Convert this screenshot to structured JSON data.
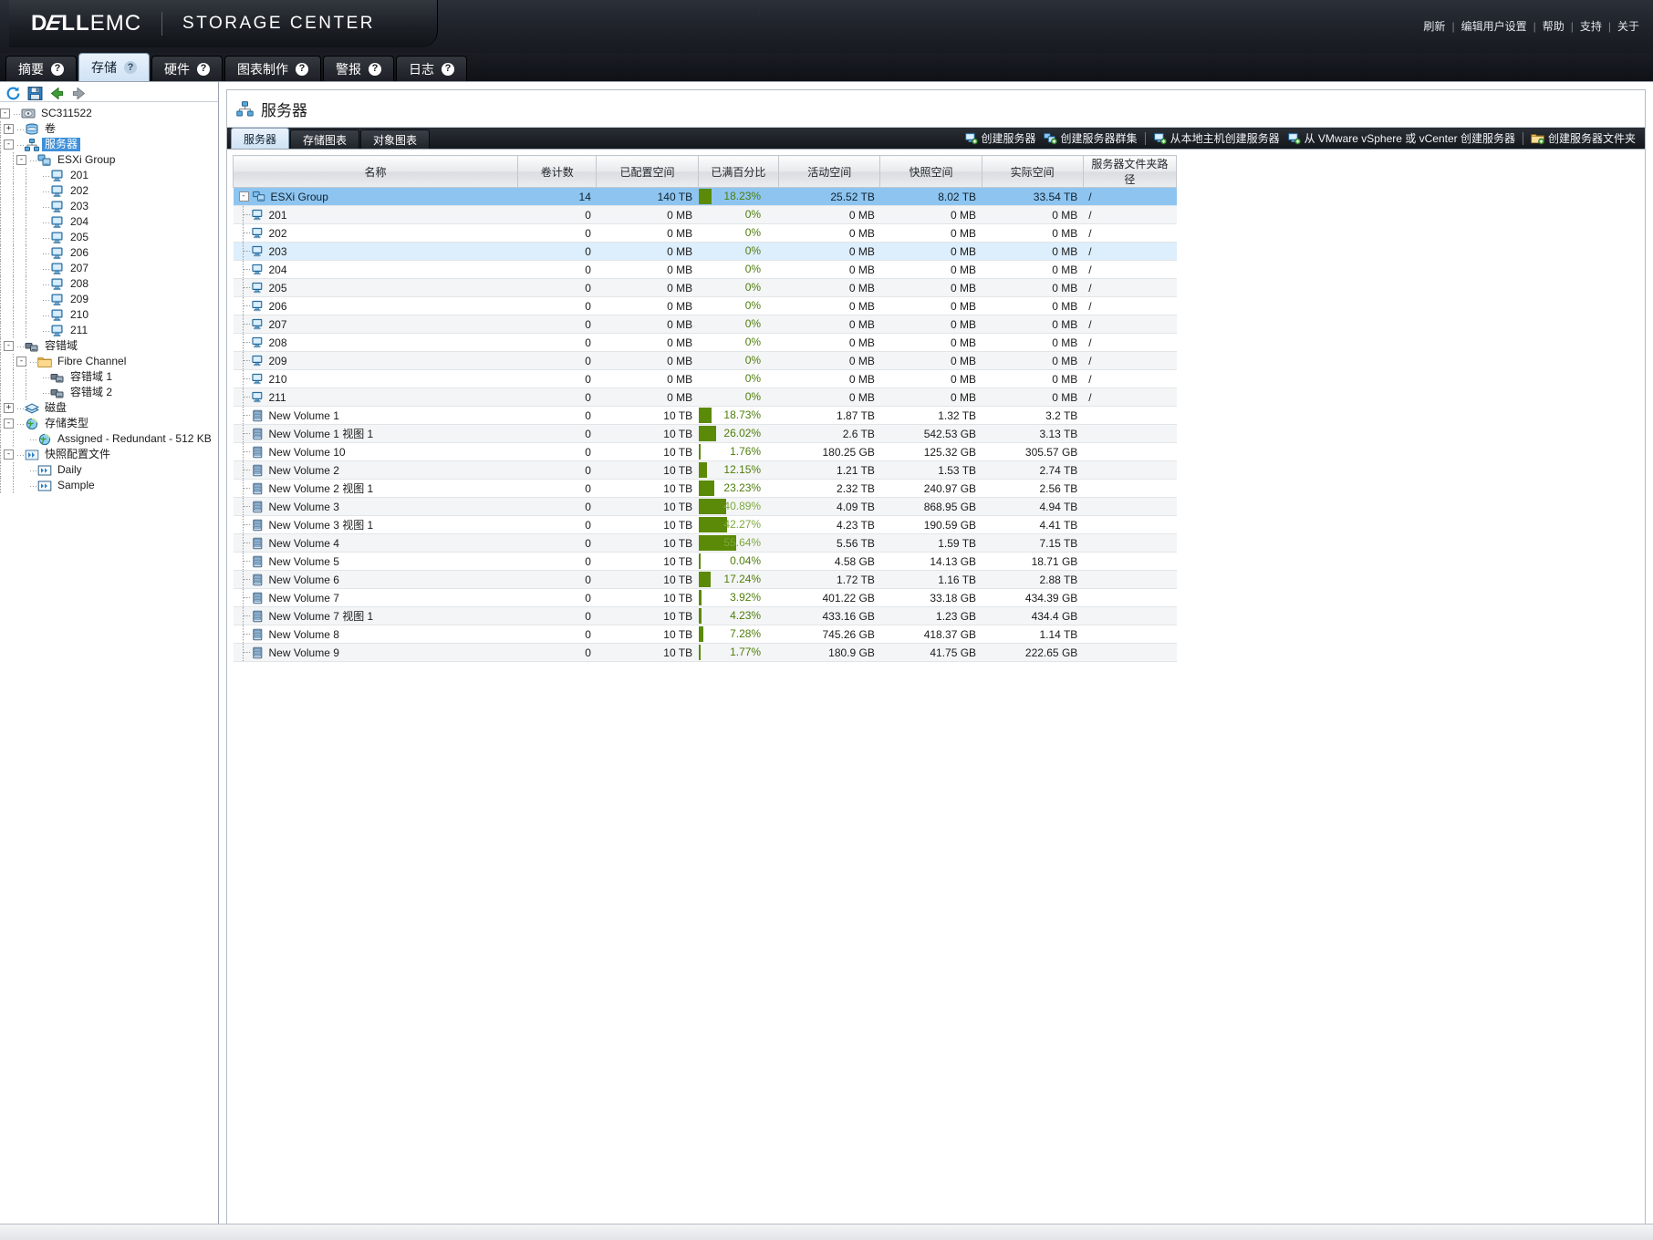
{
  "header": {
    "brand_dell": "D",
    "brand_dell_rest": "LL",
    "brand_emc": "EMC",
    "product": "STORAGE CENTER",
    "links": [
      "刷新",
      "编辑用户设置",
      "帮助",
      "支持",
      "关于"
    ]
  },
  "main_tabs": [
    {
      "label": "摘要",
      "active": false,
      "help": "?"
    },
    {
      "label": "存储",
      "active": true,
      "help": "?"
    },
    {
      "label": "硬件",
      "active": false,
      "help": "?"
    },
    {
      "label": "图表制作",
      "active": false,
      "help": "?"
    },
    {
      "label": "警报",
      "active": false,
      "help": "?"
    },
    {
      "label": "日志",
      "active": false,
      "help": "?"
    }
  ],
  "tree_toolbar": [
    {
      "name": "refresh-icon",
      "title": "刷新"
    },
    {
      "name": "save-icon",
      "title": "保存"
    },
    {
      "name": "back-arrow-icon",
      "title": "后退"
    },
    {
      "name": "forward-arrow-icon",
      "title": "前进"
    }
  ],
  "tree": [
    {
      "label": "SC311522",
      "depth": 0,
      "twist": "-",
      "icon": "storage-center-icon",
      "selected": false
    },
    {
      "label": "卷",
      "depth": 1,
      "twist": "+",
      "icon": "volumes-icon",
      "selected": false
    },
    {
      "label": "服务器",
      "depth": 1,
      "twist": "-",
      "icon": "servers-icon",
      "selected": true
    },
    {
      "label": "ESXi Group",
      "depth": 2,
      "twist": "-",
      "icon": "server-cluster-icon",
      "selected": false
    },
    {
      "label": "201",
      "depth": 3,
      "twist": "",
      "icon": "server-icon",
      "selected": false
    },
    {
      "label": "202",
      "depth": 3,
      "twist": "",
      "icon": "server-icon",
      "selected": false
    },
    {
      "label": "203",
      "depth": 3,
      "twist": "",
      "icon": "server-icon",
      "selected": false
    },
    {
      "label": "204",
      "depth": 3,
      "twist": "",
      "icon": "server-icon",
      "selected": false
    },
    {
      "label": "205",
      "depth": 3,
      "twist": "",
      "icon": "server-icon",
      "selected": false
    },
    {
      "label": "206",
      "depth": 3,
      "twist": "",
      "icon": "server-icon",
      "selected": false
    },
    {
      "label": "207",
      "depth": 3,
      "twist": "",
      "icon": "server-icon",
      "selected": false
    },
    {
      "label": "208",
      "depth": 3,
      "twist": "",
      "icon": "server-icon",
      "selected": false
    },
    {
      "label": "209",
      "depth": 3,
      "twist": "",
      "icon": "server-icon",
      "selected": false
    },
    {
      "label": "210",
      "depth": 3,
      "twist": "",
      "icon": "server-icon",
      "selected": false
    },
    {
      "label": "211",
      "depth": 3,
      "twist": "",
      "icon": "server-icon",
      "selected": false
    },
    {
      "label": "容错域",
      "depth": 1,
      "twist": "-",
      "icon": "fault-domain-icon",
      "selected": false
    },
    {
      "label": "Fibre Channel",
      "depth": 2,
      "twist": "-",
      "icon": "folder-icon",
      "selected": false
    },
    {
      "label": "容错域 1",
      "depth": 3,
      "twist": "",
      "icon": "fault-domain-icon",
      "selected": false
    },
    {
      "label": "容错域 2",
      "depth": 3,
      "twist": "",
      "icon": "fault-domain-icon",
      "selected": false
    },
    {
      "label": "磁盘",
      "depth": 1,
      "twist": "+",
      "icon": "disks-icon",
      "selected": false
    },
    {
      "label": "存储类型",
      "depth": 1,
      "twist": "-",
      "icon": "storage-type-icon",
      "selected": false
    },
    {
      "label": "Assigned - Redundant - 512 KB",
      "depth": 2,
      "twist": "",
      "icon": "storage-type-icon",
      "selected": false
    },
    {
      "label": "快照配置文件",
      "depth": 1,
      "twist": "-",
      "icon": "snapshot-profile-icon",
      "selected": false
    },
    {
      "label": "Daily",
      "depth": 2,
      "twist": "",
      "icon": "snapshot-icon",
      "selected": false
    },
    {
      "label": "Sample",
      "depth": 2,
      "twist": "",
      "icon": "snapshot-icon",
      "selected": false
    }
  ],
  "panel": {
    "title": "服务器",
    "title_icon": "servers-icon",
    "sub_tabs": [
      {
        "label": "服务器",
        "active": true
      },
      {
        "label": "存储图表",
        "active": false
      },
      {
        "label": "对象图表",
        "active": false
      }
    ],
    "actions": [
      {
        "label": "创建服务器",
        "icon": "create-server-icon",
        "sep_after": false
      },
      {
        "label": "创建服务器群集",
        "icon": "create-server-cluster-icon",
        "sep_after": true
      },
      {
        "label": "从本地主机创建服务器",
        "icon": "create-server-from-localhost-icon",
        "sep_after": false
      },
      {
        "label": "从 VMware vSphere 或 vCenter 创建服务器",
        "icon": "create-server-from-vmware-icon",
        "sep_after": true
      },
      {
        "label": "创建服务器文件夹",
        "icon": "create-server-folder-icon",
        "sep_after": false
      }
    ]
  },
  "table": {
    "columns": [
      "名称",
      "卷计数",
      "已配置空间",
      "已满百分比",
      "活动空间",
      "快照空间",
      "实际空间",
      "服务器文件夹路径"
    ],
    "rows": [
      {
        "name": "ESXi Group",
        "kind": "group",
        "icon": "server-cluster-icon",
        "twist": "-",
        "indent": 0,
        "volumes": "14",
        "configured": "140 TB",
        "percent_full": "18.23%",
        "percent_value": 18.23,
        "active": "25.52 TB",
        "snapshot": "8.02 TB",
        "actual": "33.54 TB",
        "folder": "/",
        "selected": true,
        "hover": false
      },
      {
        "name": "201",
        "kind": "server",
        "icon": "server-icon",
        "twist": "",
        "indent": 1,
        "volumes": "0",
        "configured": "0 MB",
        "percent_full": "0%",
        "percent_value": 0,
        "active": "0 MB",
        "snapshot": "0 MB",
        "actual": "0 MB",
        "folder": "/",
        "selected": false,
        "hover": false
      },
      {
        "name": "202",
        "kind": "server",
        "icon": "server-icon",
        "twist": "",
        "indent": 1,
        "volumes": "0",
        "configured": "0 MB",
        "percent_full": "0%",
        "percent_value": 0,
        "active": "0 MB",
        "snapshot": "0 MB",
        "actual": "0 MB",
        "folder": "/",
        "selected": false,
        "hover": false
      },
      {
        "name": "203",
        "kind": "server",
        "icon": "server-icon",
        "twist": "",
        "indent": 1,
        "volumes": "0",
        "configured": "0 MB",
        "percent_full": "0%",
        "percent_value": 0,
        "active": "0 MB",
        "snapshot": "0 MB",
        "actual": "0 MB",
        "folder": "/",
        "selected": false,
        "hover": true
      },
      {
        "name": "204",
        "kind": "server",
        "icon": "server-icon",
        "twist": "",
        "indent": 1,
        "volumes": "0",
        "configured": "0 MB",
        "percent_full": "0%",
        "percent_value": 0,
        "active": "0 MB",
        "snapshot": "0 MB",
        "actual": "0 MB",
        "folder": "/",
        "selected": false,
        "hover": false
      },
      {
        "name": "205",
        "kind": "server",
        "icon": "server-icon",
        "twist": "",
        "indent": 1,
        "volumes": "0",
        "configured": "0 MB",
        "percent_full": "0%",
        "percent_value": 0,
        "active": "0 MB",
        "snapshot": "0 MB",
        "actual": "0 MB",
        "folder": "/",
        "selected": false,
        "hover": false
      },
      {
        "name": "206",
        "kind": "server",
        "icon": "server-icon",
        "twist": "",
        "indent": 1,
        "volumes": "0",
        "configured": "0 MB",
        "percent_full": "0%",
        "percent_value": 0,
        "active": "0 MB",
        "snapshot": "0 MB",
        "actual": "0 MB",
        "folder": "/",
        "selected": false,
        "hover": false
      },
      {
        "name": "207",
        "kind": "server",
        "icon": "server-icon",
        "twist": "",
        "indent": 1,
        "volumes": "0",
        "configured": "0 MB",
        "percent_full": "0%",
        "percent_value": 0,
        "active": "0 MB",
        "snapshot": "0 MB",
        "actual": "0 MB",
        "folder": "/",
        "selected": false,
        "hover": false
      },
      {
        "name": "208",
        "kind": "server",
        "icon": "server-icon",
        "twist": "",
        "indent": 1,
        "volumes": "0",
        "configured": "0 MB",
        "percent_full": "0%",
        "percent_value": 0,
        "active": "0 MB",
        "snapshot": "0 MB",
        "actual": "0 MB",
        "folder": "/",
        "selected": false,
        "hover": false
      },
      {
        "name": "209",
        "kind": "server",
        "icon": "server-icon",
        "twist": "",
        "indent": 1,
        "volumes": "0",
        "configured": "0 MB",
        "percent_full": "0%",
        "percent_value": 0,
        "active": "0 MB",
        "snapshot": "0 MB",
        "actual": "0 MB",
        "folder": "/",
        "selected": false,
        "hover": false
      },
      {
        "name": "210",
        "kind": "server",
        "icon": "server-icon",
        "twist": "",
        "indent": 1,
        "volumes": "0",
        "configured": "0 MB",
        "percent_full": "0%",
        "percent_value": 0,
        "active": "0 MB",
        "snapshot": "0 MB",
        "actual": "0 MB",
        "folder": "/",
        "selected": false,
        "hover": false
      },
      {
        "name": "211",
        "kind": "server",
        "icon": "server-icon",
        "twist": "",
        "indent": 1,
        "volumes": "0",
        "configured": "0 MB",
        "percent_full": "0%",
        "percent_value": 0,
        "active": "0 MB",
        "snapshot": "0 MB",
        "actual": "0 MB",
        "folder": "/",
        "selected": false,
        "hover": false
      },
      {
        "name": "New Volume 1",
        "kind": "volume",
        "icon": "volume-icon",
        "twist": "",
        "indent": 1,
        "volumes": "0",
        "configured": "10 TB",
        "percent_full": "18.73%",
        "percent_value": 18.73,
        "active": "1.87 TB",
        "snapshot": "1.32 TB",
        "actual": "3.2 TB",
        "folder": "",
        "selected": false,
        "hover": false
      },
      {
        "name": "New Volume 1 视图 1",
        "kind": "volume",
        "icon": "volume-icon",
        "twist": "",
        "indent": 1,
        "volumes": "0",
        "configured": "10 TB",
        "percent_full": "26.02%",
        "percent_value": 26.02,
        "active": "2.6 TB",
        "snapshot": "542.53 GB",
        "actual": "3.13 TB",
        "folder": "",
        "selected": false,
        "hover": false
      },
      {
        "name": "New Volume 10",
        "kind": "volume",
        "icon": "volume-icon",
        "twist": "",
        "indent": 1,
        "volumes": "0",
        "configured": "10 TB",
        "percent_full": "1.76%",
        "percent_value": 1.76,
        "active": "180.25 GB",
        "snapshot": "125.32 GB",
        "actual": "305.57 GB",
        "folder": "",
        "selected": false,
        "hover": false
      },
      {
        "name": "New Volume 2",
        "kind": "volume",
        "icon": "volume-icon",
        "twist": "",
        "indent": 1,
        "volumes": "0",
        "configured": "10 TB",
        "percent_full": "12.15%",
        "percent_value": 12.15,
        "active": "1.21 TB",
        "snapshot": "1.53 TB",
        "actual": "2.74 TB",
        "folder": "",
        "selected": false,
        "hover": false
      },
      {
        "name": "New Volume 2 视图 1",
        "kind": "volume",
        "icon": "volume-icon",
        "twist": "",
        "indent": 1,
        "volumes": "0",
        "configured": "10 TB",
        "percent_full": "23.23%",
        "percent_value": 23.23,
        "active": "2.32 TB",
        "snapshot": "240.97 GB",
        "actual": "2.56 TB",
        "folder": "",
        "selected": false,
        "hover": false
      },
      {
        "name": "New Volume 3",
        "kind": "volume",
        "icon": "volume-icon",
        "twist": "",
        "indent": 1,
        "volumes": "0",
        "configured": "10 TB",
        "percent_full": "40.89%",
        "percent_value": 40.89,
        "active": "4.09 TB",
        "snapshot": "868.95 GB",
        "actual": "4.94 TB",
        "folder": "",
        "selected": false,
        "hover": false
      },
      {
        "name": "New Volume 3 视图 1",
        "kind": "volume",
        "icon": "volume-icon",
        "twist": "",
        "indent": 1,
        "volumes": "0",
        "configured": "10 TB",
        "percent_full": "42.27%",
        "percent_value": 42.27,
        "active": "4.23 TB",
        "snapshot": "190.59 GB",
        "actual": "4.41 TB",
        "folder": "",
        "selected": false,
        "hover": false
      },
      {
        "name": "New Volume 4",
        "kind": "volume",
        "icon": "volume-icon",
        "twist": "",
        "indent": 1,
        "volumes": "0",
        "configured": "10 TB",
        "percent_full": "55.64%",
        "percent_value": 55.64,
        "active": "5.56 TB",
        "snapshot": "1.59 TB",
        "actual": "7.15 TB",
        "folder": "",
        "selected": false,
        "hover": false
      },
      {
        "name": "New Volume 5",
        "kind": "volume",
        "icon": "volume-icon",
        "twist": "",
        "indent": 1,
        "volumes": "0",
        "configured": "10 TB",
        "percent_full": "0.04%",
        "percent_value": 0.04,
        "active": "4.58 GB",
        "snapshot": "14.13 GB",
        "actual": "18.71 GB",
        "folder": "",
        "selected": false,
        "hover": false
      },
      {
        "name": "New Volume 6",
        "kind": "volume",
        "icon": "volume-icon",
        "twist": "",
        "indent": 1,
        "volumes": "0",
        "configured": "10 TB",
        "percent_full": "17.24%",
        "percent_value": 17.24,
        "active": "1.72 TB",
        "snapshot": "1.16 TB",
        "actual": "2.88 TB",
        "folder": "",
        "selected": false,
        "hover": false
      },
      {
        "name": "New Volume 7",
        "kind": "volume",
        "icon": "volume-icon",
        "twist": "",
        "indent": 1,
        "volumes": "0",
        "configured": "10 TB",
        "percent_full": "3.92%",
        "percent_value": 3.92,
        "active": "401.22 GB",
        "snapshot": "33.18 GB",
        "actual": "434.39 GB",
        "folder": "",
        "selected": false,
        "hover": false
      },
      {
        "name": "New Volume 7 视图 1",
        "kind": "volume",
        "icon": "volume-icon",
        "twist": "",
        "indent": 1,
        "volumes": "0",
        "configured": "10 TB",
        "percent_full": "4.23%",
        "percent_value": 4.23,
        "active": "433.16 GB",
        "snapshot": "1.23 GB",
        "actual": "434.4 GB",
        "folder": "",
        "selected": false,
        "hover": false
      },
      {
        "name": "New Volume 8",
        "kind": "volume",
        "icon": "volume-icon",
        "twist": "",
        "indent": 1,
        "volumes": "0",
        "configured": "10 TB",
        "percent_full": "7.28%",
        "percent_value": 7.28,
        "active": "745.26 GB",
        "snapshot": "418.37 GB",
        "actual": "1.14 TB",
        "folder": "",
        "selected": false,
        "hover": false
      },
      {
        "name": "New Volume 9",
        "kind": "volume",
        "icon": "volume-icon",
        "twist": "",
        "indent": 1,
        "volumes": "0",
        "configured": "10 TB",
        "percent_full": "1.77%",
        "percent_value": 1.77,
        "active": "180.9 GB",
        "snapshot": "41.75 GB",
        "actual": "222.65 GB",
        "folder": "",
        "selected": false,
        "hover": false
      }
    ]
  },
  "colors": {
    "accent_blue": "#3d90d9",
    "selected_row": "#8ec5f0",
    "hover_row": "#ddeefc",
    "bar_green": "#5b8a08",
    "pct_text_green": "#4e7d0a"
  }
}
